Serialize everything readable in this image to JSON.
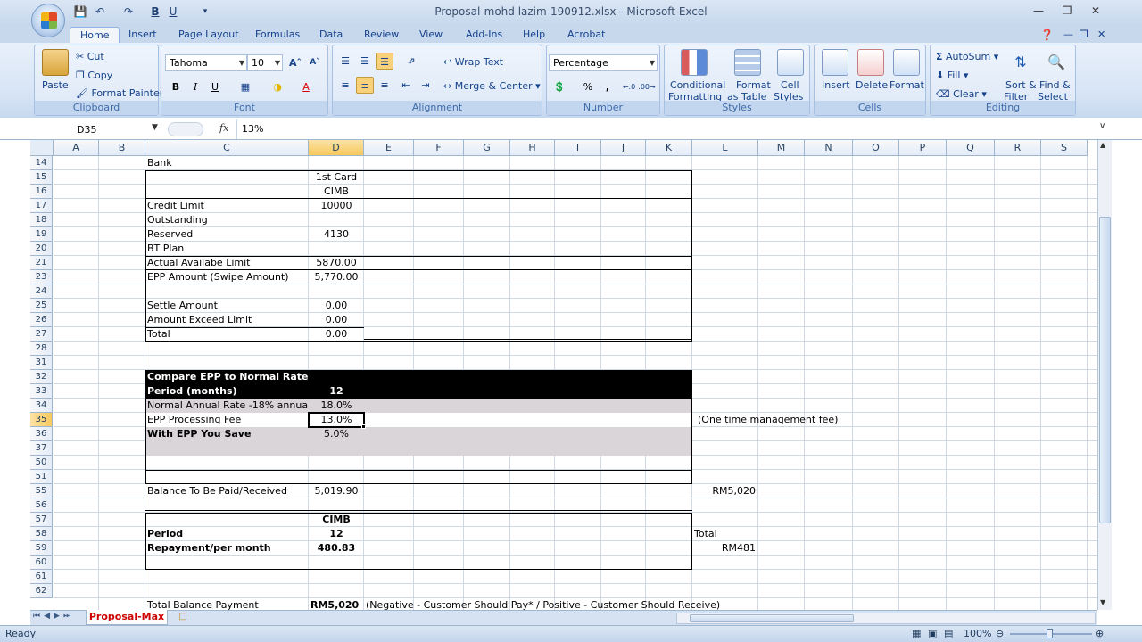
{
  "window": {
    "title": "Proposal-mohd lazim-190912.xlsx - Microsoft Excel"
  },
  "ribbon_tabs": [
    "Home",
    "Insert",
    "Page Layout",
    "Formulas",
    "Data",
    "Review",
    "View",
    "Add-Ins",
    "Help",
    "Acrobat"
  ],
  "clipboard": {
    "paste": "Paste",
    "cut": "Cut",
    "copy": "Copy",
    "format_painter": "Format Painter",
    "label": "Clipboard"
  },
  "font": {
    "name": "Tahoma",
    "size": "10",
    "label": "Font"
  },
  "alignment": {
    "wrap": "Wrap Text",
    "merge": "Merge & Center",
    "label": "Alignment"
  },
  "number": {
    "format": "Percentage",
    "label": "Number"
  },
  "styles": {
    "conditional_1": "Conditional",
    "conditional_2": "Formatting",
    "format_table_1": "Format",
    "format_table_2": "as Table",
    "cell_styles_1": "Cell",
    "cell_styles_2": "Styles",
    "label": "Styles"
  },
  "cells_group": {
    "insert": "Insert",
    "delete": "Delete",
    "format": "Format",
    "label": "Cells"
  },
  "editing": {
    "autosum": "AutoSum",
    "fill": "Fill",
    "clear": "Clear",
    "sort_1": "Sort &",
    "sort_2": "Filter",
    "find_1": "Find &",
    "find_2": "Select",
    "label": "Editing"
  },
  "formula_bar": {
    "name_box": "D35",
    "fx": "fx",
    "value": "13%"
  },
  "columns": [
    "A",
    "B",
    "C",
    "D",
    "E",
    "F",
    "G",
    "H",
    "I",
    "J",
    "K",
    "L",
    "M",
    "N",
    "O",
    "P",
    "Q",
    "R",
    "S"
  ],
  "rows": [
    "14",
    "15",
    "16",
    "17",
    "18",
    "19",
    "20",
    "21",
    "23",
    "24",
    "25",
    "26",
    "27",
    "28",
    "31",
    "32",
    "33",
    "34",
    "35",
    "36",
    "37",
    "50",
    "51",
    "55",
    "56",
    "57",
    "58",
    "59",
    "60",
    "61",
    "62"
  ],
  "cells": {
    "c14": "Bank",
    "d15": "1st Card",
    "d16": "CIMB",
    "c17": "Credit Limit",
    "d17": "10000",
    "c18": "Outstanding",
    "c19": "Reserved",
    "d19": "4130",
    "c20": "BT Plan",
    "c21": "Actual Availabe Limit",
    "d21": "5870.00",
    "c23": "EPP Amount (Swipe Amount)",
    "d23": "5,770.00",
    "c25": "Settle Amount",
    "d25": "0.00",
    "c26": "Amount Exceed Limit",
    "d26": "0.00",
    "c27": "Total",
    "d27": "0.00",
    "c32": "Compare EPP to Normal Rate",
    "c33": "Period (months)",
    "d33": "12",
    "c34": "Normal Annual Rate -18% annua",
    "d34": "18.0%",
    "c35": "EPP Processing Fee",
    "d35": "13.0%",
    "l35": "(One time management fee)",
    "c36": "With EPP You Save",
    "d36": "5.0%",
    "c55": "Balance To Be Paid/Received",
    "d55": "5,019.90",
    "l55": "RM5,020",
    "d57": "CIMB",
    "c58": "Period",
    "d58": "12",
    "l58": "Total",
    "c59": "Repayment/per month",
    "d59": "480.83",
    "l59": "RM481",
    "c63": "Total Balance Payment",
    "d63": "RM5,020",
    "e63": "(Negative - Customer Should Pay* / Positive - Customer Should Receive)"
  },
  "sheet_tab": "Proposal-Max",
  "status": {
    "ready": "Ready",
    "zoom": "100%"
  }
}
